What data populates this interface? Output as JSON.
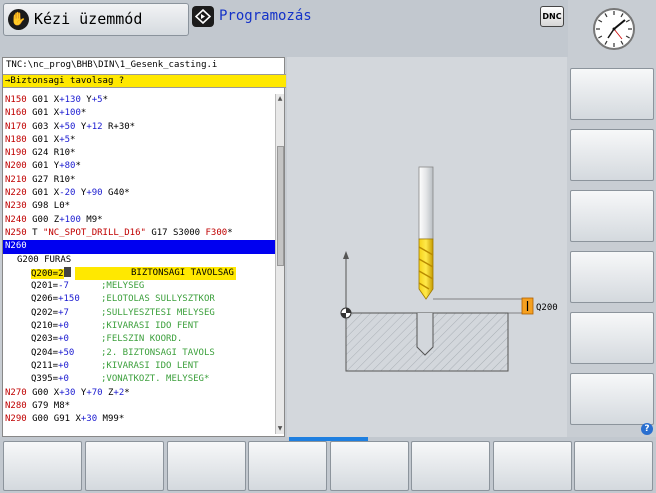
{
  "header": {
    "mode_label": "Kézi üzemmód",
    "mode_icon": "hand-icon",
    "program_label": "Programozás",
    "program_icon": "edit-diamond-icon",
    "dnc_label": "DNC",
    "clock_icon": "clock-icon"
  },
  "program": {
    "path": "TNC:\\nc_prog\\BHB\\DIN\\1_Gesenk_casting.i",
    "prompt": "→Biztonsagi tavolsag ?",
    "lines": [
      {
        "n": "N150",
        "t1": " G01 X",
        "v1": "+130",
        "t2": " Y",
        "v2": "+5",
        "t3": "*"
      },
      {
        "n": "N160",
        "t1": " G01 X",
        "v1": "+100",
        "t2": "",
        "v2": "",
        "t3": "*"
      },
      {
        "n": "N170",
        "t1": " G03 X",
        "v1": "+50",
        "t2": " Y",
        "v2": "+12",
        "t3": " R+30*"
      },
      {
        "n": "N180",
        "t1": " G01 X",
        "v1": "+5",
        "t2": "",
        "v2": "",
        "t3": "*"
      },
      {
        "n": "N190",
        "t1": " G24 R10",
        "v1": "",
        "t2": "",
        "v2": "",
        "t3": "*"
      },
      {
        "n": "N200",
        "t1": " G01 Y",
        "v1": "+80",
        "t2": "",
        "v2": "",
        "t3": "*"
      },
      {
        "n": "N210",
        "t1": " G27 R10",
        "v1": "",
        "t2": "",
        "v2": "",
        "t3": "*"
      },
      {
        "n": "N220",
        "t1": " G01 X",
        "v1": "-20",
        "t2": " Y",
        "v2": "+90",
        "t3": " G40*"
      },
      {
        "n": "N230",
        "t1": " G98 L0",
        "v1": "",
        "t2": "",
        "v2": "",
        "t3": "*"
      },
      {
        "n": "N240",
        "t1": " G00 Z",
        "v1": "+100",
        "t2": " M9",
        "v2": "",
        "t3": "*"
      }
    ],
    "line_250": {
      "n": "N250",
      "a": " T ",
      "s": "\"NC_SPOT_DRILL_D16\"",
      "b": " G17 S3000 ",
      "f": "F300",
      "e": "*"
    },
    "line_260": "N260",
    "cycle_header": "G200 FURAS",
    "cycle_active_param": "Q200=2",
    "cycle_active_comment": "BIZTONSAGI TAVOLSAG",
    "cycle_params": [
      {
        "q": "Q201=",
        "v": "-7",
        "c": ";MELYSEG"
      },
      {
        "q": "Q206=",
        "v": "+150",
        "c": ";ELOTOLAS SULLYSZTKOR"
      },
      {
        "q": "Q202=",
        "v": "+7",
        "c": ";SULLYESZTESI MELYSEG"
      },
      {
        "q": "Q210=",
        "v": "+0",
        "c": ";KIVARASI IDO FENT"
      },
      {
        "q": "Q203=",
        "v": "+0",
        "c": ";FELSZIN KOORD."
      },
      {
        "q": "Q204=",
        "v": "+50",
        "c": ";2. BIZTONSAGI TAVOLS"
      },
      {
        "q": "Q211=",
        "v": "+0",
        "c": ";KIVARASI IDO LENT"
      },
      {
        "q": "Q395=",
        "v": "+0",
        "c": ";VONATKOZT. MELYSEG*"
      }
    ],
    "tail_lines": [
      {
        "n": "N270",
        "t1": " G00 X",
        "v1": "+30",
        "t2": " Y",
        "v2": "+70",
        "t3": " Z",
        "v3": "+2",
        "e": "*"
      },
      {
        "n": "N280",
        "t1": " G79 M8",
        "v1": "",
        "t2": "",
        "v2": "",
        "t3": "",
        "v3": "",
        "e": "*"
      },
      {
        "n": "N290",
        "t1": " G00 G91 X",
        "v1": "+30",
        "t2": " M99",
        "v2": "",
        "t3": "",
        "v3": "",
        "e": "*"
      }
    ]
  },
  "graphic": {
    "dimension_label": "Q200"
  },
  "colors": {
    "prompt_bg": "#ffe800",
    "selected_line": "#0000f0",
    "line_number": "#c00000",
    "value": "#1a1ad0",
    "accent": "#1e7fe0"
  }
}
